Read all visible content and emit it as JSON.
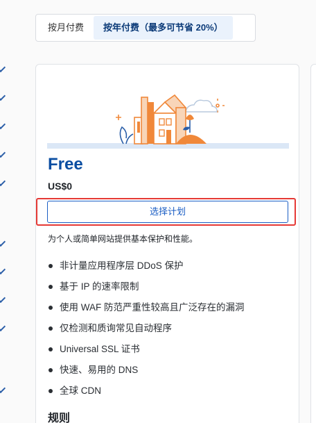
{
  "billing_toggle": {
    "monthly_label": "按月付费",
    "yearly_label": "按年付费（最多可节省 20%）"
  },
  "plan": {
    "name": "Free",
    "price": "US$0",
    "select_label": "选择计划",
    "description": "为个人或简单网站提供基本保护和性能。",
    "features": [
      "非计量应用程序层 DDoS 保护",
      "基于 IP 的速率限制",
      "使用 WAF 防范严重性较高且广泛存在的漏洞",
      "仅检测和质询常见自动程序",
      "Universal SSL 证书",
      "快速、易用的 DNS",
      "全球 CDN"
    ],
    "rules_title": "规则"
  },
  "colors": {
    "accent": "#1a5dc4",
    "plan_name": "#0b4ea2",
    "highlight": "#e53935",
    "illustration_orange": "#f0883a"
  }
}
